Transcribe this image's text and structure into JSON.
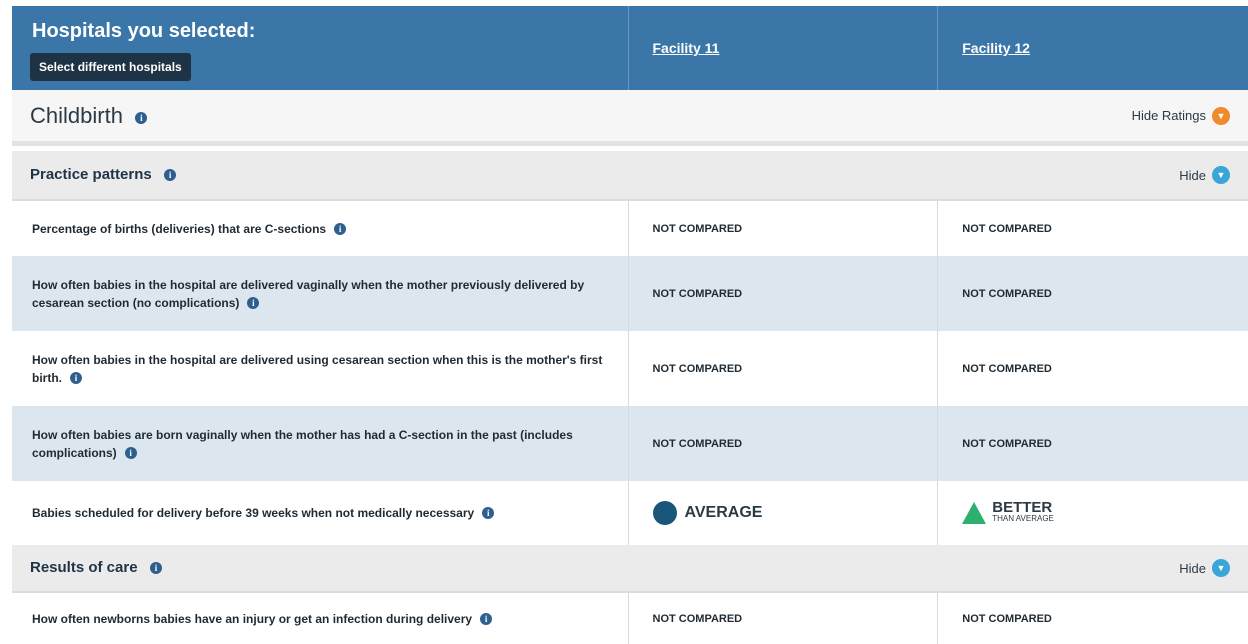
{
  "header": {
    "title": "Hospitals you selected:",
    "select_button": "Select different hospitals",
    "facilities": [
      "Facility 11",
      "Facility 12"
    ]
  },
  "childbirth": {
    "title": "Childbirth",
    "hide_ratings": "Hide Ratings"
  },
  "practice_patterns": {
    "title": "Practice patterns",
    "hide": "Hide",
    "rows": [
      {
        "label": "Percentage of births (deliveries) that are C-sections",
        "f11": "NOT COMPARED",
        "f12": "NOT COMPARED"
      },
      {
        "label": "How often babies in the hospital are delivered vaginally when the mother previously delivered by cesarean section (no complications)",
        "f11": "NOT COMPARED",
        "f12": "NOT COMPARED"
      },
      {
        "label": "How often babies in the hospital are delivered using cesarean section when this is the mother's first birth.",
        "f11": "NOT COMPARED",
        "f12": "NOT COMPARED"
      },
      {
        "label": "How often babies are born vaginally when the mother has had a C-section in the past (includes complications)",
        "f11": "NOT COMPARED",
        "f12": "NOT COMPARED"
      },
      {
        "label": "Babies scheduled for delivery before 39 weeks when not medically necessary",
        "f11": "AVERAGE",
        "f12_main": "BETTER",
        "f12_sub": "THAN AVERAGE"
      }
    ]
  },
  "results_of_care": {
    "title": "Results of care",
    "hide": "Hide",
    "rows": [
      {
        "label": "How often newborns babies have an injury or get an infection during delivery",
        "f11": "NOT COMPARED",
        "f12": "NOT COMPARED"
      }
    ]
  },
  "colors": {
    "header_bg": "#3a77a8",
    "average": "#1a5679",
    "better": "#2eaf6e",
    "hide_ratings_btn": "#f08a2c",
    "hide_btn": "#3aa6d8"
  },
  "icons": {
    "info": "info-icon",
    "chevron": "chevron-down-icon"
  }
}
